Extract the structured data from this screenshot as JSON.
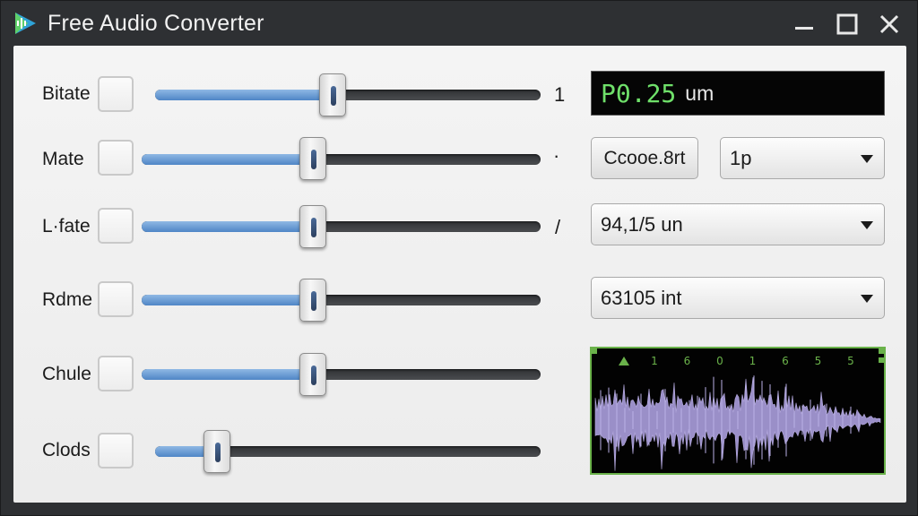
{
  "window": {
    "title": "Free Audio Converter"
  },
  "colors": {
    "accent_blue": "#5a8fcc",
    "lcd_green": "#6fe06a",
    "waveform_purple": "#9a8fc8",
    "waveform_frame_green": "#6ab24a"
  },
  "rows": [
    {
      "label": "Bitate",
      "slider_level": 0.46,
      "tick": "1"
    },
    {
      "label": "Mate",
      "slider_level": 0.43,
      "tick": "·"
    },
    {
      "label": "L·fate",
      "slider_level": 0.43,
      "tick": "/"
    },
    {
      "label": "Rdme",
      "slider_level": 0.43,
      "tick": ""
    },
    {
      "label": "Chule",
      "slider_level": 0.43,
      "tick": ""
    },
    {
      "label": "Clods",
      "slider_level": 0.16,
      "tick": ""
    }
  ],
  "display": {
    "value": "P0.25",
    "unit": "um"
  },
  "controls": {
    "button_label": "Ccooe.8rt",
    "select_small_value": "1p",
    "select_rate_value": "94,1/5 un",
    "select_count_value": "63105 int"
  },
  "waveform": {
    "ruler_labels": [
      "1",
      "6",
      "0",
      "1",
      "6",
      "5",
      "5"
    ]
  }
}
